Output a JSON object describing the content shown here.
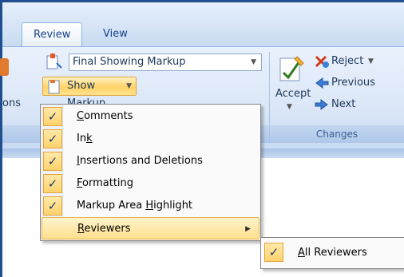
{
  "tabs": [
    {
      "label": "Review",
      "active": true
    },
    {
      "label": "View",
      "active": false
    }
  ],
  "tracking": {
    "partial_label": "ons",
    "display_combo": "Final Showing Markup",
    "show_markup_label": "Show Markup"
  },
  "changes": {
    "accept_label": "Accept",
    "reject_label": "Reject",
    "previous_label": "Previous",
    "next_label": "Next",
    "group_title": "Changes"
  },
  "menu": {
    "items": [
      {
        "prefix": "",
        "accel": "C",
        "rest": "omments",
        "checked": true
      },
      {
        "prefix": "In",
        "accel": "k",
        "rest": "",
        "checked": true
      },
      {
        "prefix": "",
        "accel": "I",
        "rest": "nsertions and Deletions",
        "checked": true
      },
      {
        "prefix": "",
        "accel": "F",
        "rest": "ormatting",
        "checked": true
      },
      {
        "prefix": "Markup Area ",
        "accel": "H",
        "rest": "ighlight",
        "checked": true
      },
      {
        "prefix": "",
        "accel": "R",
        "rest": "eviewers",
        "checked": false,
        "submenu": true
      }
    ]
  },
  "submenu": {
    "items": [
      {
        "prefix": "",
        "accel": "A",
        "rest": "ll Reviewers",
        "checked": true
      }
    ]
  },
  "icons": {
    "check": "✓",
    "dropdown": "▼",
    "submenu_arrow": "▶"
  },
  "colors": {
    "ribbon_bg": "#dbe7f7",
    "highlight": "#ffd366",
    "frame": "#1f4f8f",
    "text": "#15428b"
  }
}
